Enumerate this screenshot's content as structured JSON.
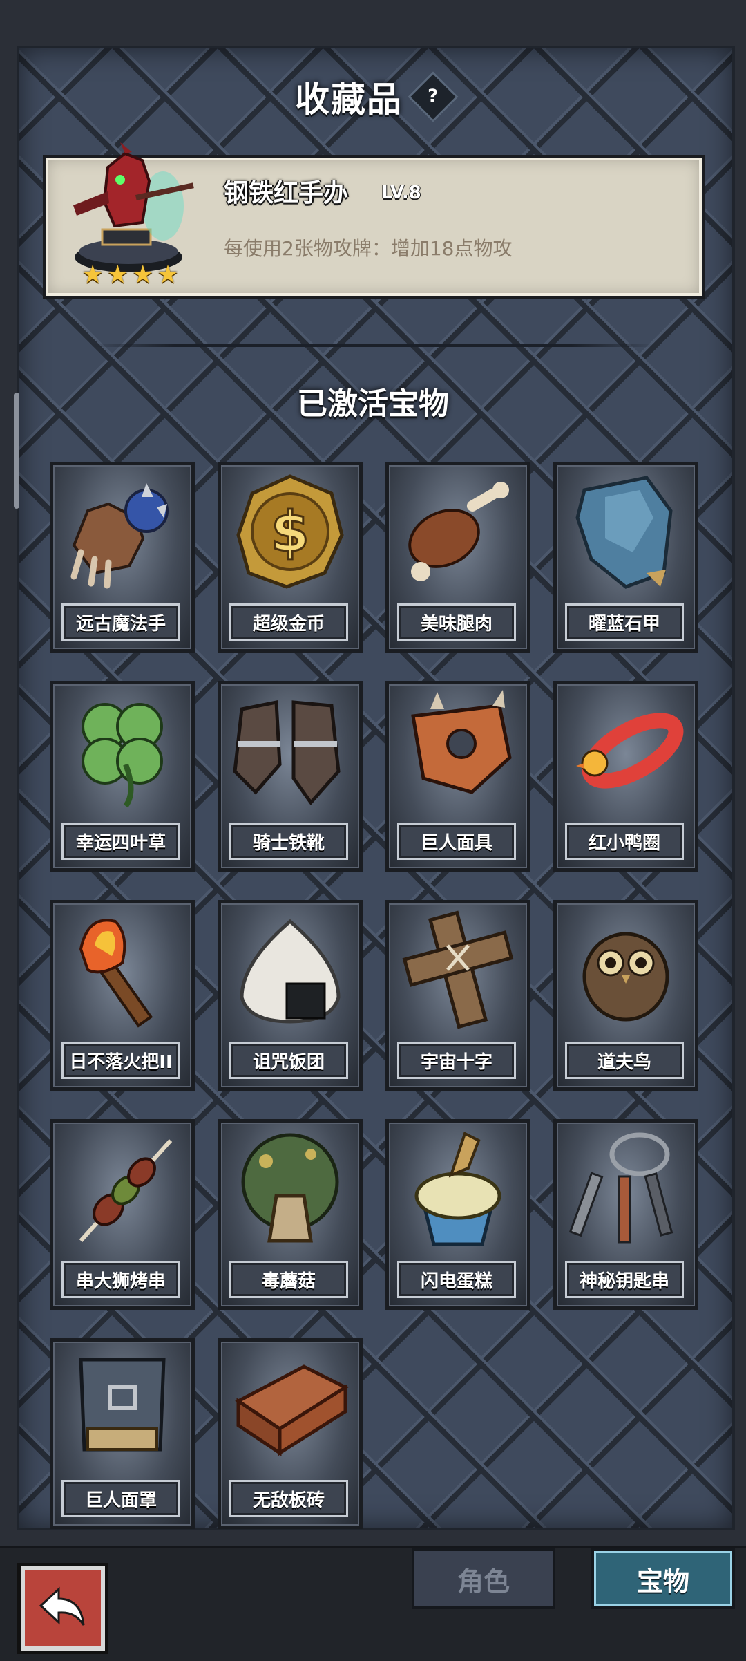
{
  "header": {
    "title": "收藏品",
    "help_icon": "?"
  },
  "featured": {
    "name": "钢铁红手办",
    "level": "LV.8",
    "description": "每使用2张物攻牌：增加18点物攻",
    "stars": 4
  },
  "section": {
    "title": "已激活宝物"
  },
  "treasures": [
    {
      "label": "远古魔法手",
      "icon": "gauntlet-icon"
    },
    {
      "label": "超级金币",
      "icon": "gold-coin-icon"
    },
    {
      "label": "美味腿肉",
      "icon": "meat-leg-icon"
    },
    {
      "label": "曜蓝石甲",
      "icon": "blue-armor-icon"
    },
    {
      "label": "幸运四叶草",
      "icon": "four-leaf-clover-icon"
    },
    {
      "label": "骑士铁靴",
      "icon": "iron-boots-icon"
    },
    {
      "label": "巨人面具",
      "icon": "giant-mask-icon"
    },
    {
      "label": "红小鸭圈",
      "icon": "duck-ring-icon"
    },
    {
      "label": "日不落火把II",
      "icon": "torch-icon"
    },
    {
      "label": "诅咒饭团",
      "icon": "rice-ball-icon"
    },
    {
      "label": "宇宙十字",
      "icon": "wooden-cross-icon"
    },
    {
      "label": "道夫鸟",
      "icon": "owl-icon"
    },
    {
      "label": "串大狮烤串",
      "icon": "kebab-icon"
    },
    {
      "label": "毒蘑菇",
      "icon": "mushroom-icon"
    },
    {
      "label": "闪电蛋糕",
      "icon": "cupcake-icon"
    },
    {
      "label": "神秘钥匙串",
      "icon": "key-ring-icon"
    },
    {
      "label": "巨人面罩",
      "icon": "face-guard-icon"
    },
    {
      "label": "无敌板砖",
      "icon": "brick-icon"
    }
  ],
  "bottom_nav": {
    "back_icon": "back-arrow-icon",
    "tab_character": "角色",
    "tab_treasure": "宝物"
  },
  "colors": {
    "active_tab": "#2f6477",
    "back_button": "#b9443b",
    "stars": "#f6c53a"
  }
}
